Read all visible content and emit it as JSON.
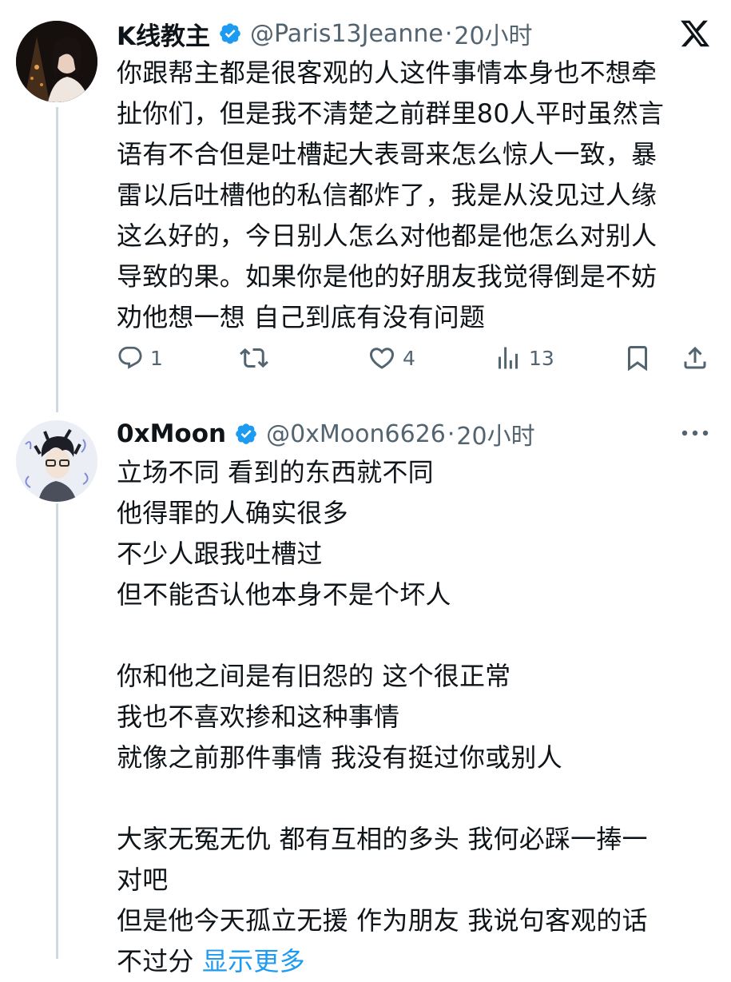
{
  "tweet1": {
    "display_name": "K线教主",
    "handle": "@Paris13Jeanne",
    "separator": "·",
    "time": "20小时",
    "text": "你跟帮主都是很客观的人这件事情本身也不想牵\n扯你们，但是我不清楚之前群里80人平时虽然言\n语有不合但是吐槽起大表哥来怎么惊人一致，暴\n雷以后吐槽他的私信都炸了，我是从没见过人缘\n这么好的，今日别人怎么对他都是他怎么对别人\n导致的果。如果你是他的好朋友我觉得倒是不妨\n劝他想一想 自己到底有没有问题",
    "actions": {
      "reply_count": "1",
      "retweet_count": "",
      "like_count": "4",
      "view_count": "13"
    }
  },
  "tweet2": {
    "display_name": "0xMoon",
    "handle": "@0xMoon6626",
    "separator": "·",
    "time": "20小时",
    "text": "立场不同 看到的东西就不同\n他得罪的人确实很多\n不少人跟我吐槽过\n但不能否认他本身不是个坏人\n\n你和他之间是有旧怨的 这个很正常\n我也不喜欢掺和这种事情\n就像之前那件事情 我没有挺过你或别人\n\n大家无冤无仇 都有互相的多头 我何必踩一捧一\n对吧\n但是他今天孤立无援 作为朋友 我说句客观的话\n不过分 ",
    "show_more": "显示更多"
  },
  "icons": {
    "brand": "x-logo-icon",
    "verified": "verified-badge-icon",
    "reply": "reply-icon",
    "retweet": "retweet-icon",
    "like": "heart-icon",
    "views": "views-icon",
    "bookmark": "bookmark-icon",
    "share": "share-icon",
    "more": "more-options-icon"
  },
  "colors": {
    "text": "#0f1419",
    "secondary": "#536471",
    "link": "#1d9bf0",
    "verified": "#1d9bf0",
    "thread_line": "#cfd9de"
  }
}
